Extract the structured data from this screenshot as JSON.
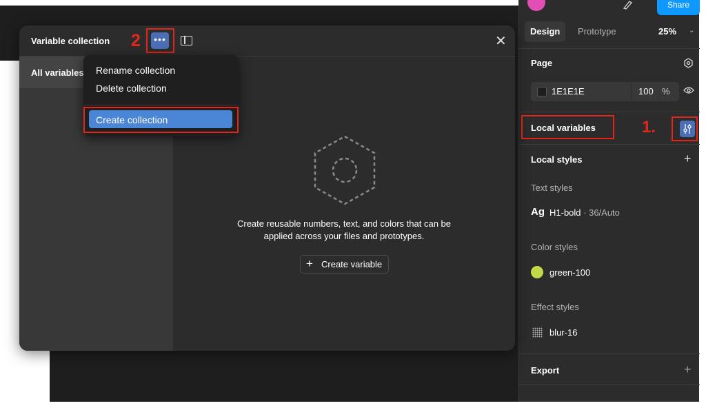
{
  "modal": {
    "title": "Variable collection",
    "step_marker": "2",
    "more_button": "•••",
    "close": "✕",
    "sidebar": {
      "all_variables": "All variables"
    },
    "empty_state": {
      "line1": "Create reusable numbers, text, and colors that can be",
      "line2": "applied across your files and prototypes.",
      "create_variable": "Create variable"
    }
  },
  "menu": {
    "items": [
      "Rename collection",
      "Delete collection"
    ],
    "active_item": "Create collection"
  },
  "right_panel": {
    "share": "Share",
    "tabs": [
      "Design",
      "Prototype"
    ],
    "zoom": "25%",
    "page": {
      "title": "Page",
      "fill_hex": "1E1E1E",
      "opacity": "100",
      "opacity_unit": "%"
    },
    "local_variables": {
      "title": "Local variables",
      "step_marker": "1."
    },
    "local_styles": {
      "title": "Local styles",
      "text_styles_title": "Text styles",
      "text_style_preview": "Ag",
      "text_style_name": "H1-bold",
      "text_style_meta": " · 36/Auto",
      "color_styles_title": "Color styles",
      "color_style_name": "green-100",
      "effect_styles_title": "Effect styles",
      "effect_style_name": "blur-16"
    },
    "export": {
      "title": "Export"
    }
  },
  "colors": {
    "annotation_red": "#e3261c",
    "accent_blue": "#4b86d6",
    "green_100": "#c3d94a",
    "panel_bg": "#2c2c2c"
  }
}
